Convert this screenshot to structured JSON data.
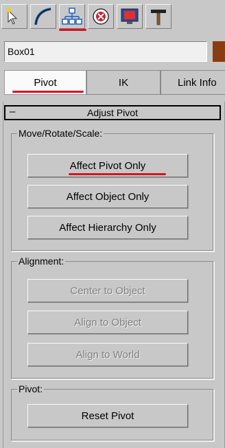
{
  "toolbar": {
    "icons": [
      "create-icon",
      "modify-icon",
      "hierarchy-icon",
      "motion-icon",
      "display-icon",
      "utilities-icon"
    ],
    "active": "hierarchy-icon",
    "accent": "#e0101a"
  },
  "object": {
    "name": "Box01",
    "color": "#8a3c12"
  },
  "tabs": [
    {
      "label": "Pivot"
    },
    {
      "label": "IK"
    },
    {
      "label": "Link Info"
    }
  ],
  "rollout": {
    "collapse_symbol": "–",
    "title": "Adjust Pivot",
    "move_group": {
      "legend": "Move/Rotate/Scale:",
      "buttons": [
        "Affect Pivot Only",
        "Affect Object Only",
        "Affect Hierarchy Only"
      ]
    },
    "alignment_group": {
      "legend": "Alignment:",
      "buttons": [
        "Center to Object",
        "Align to Object",
        "Align to World"
      ]
    },
    "pivot_group": {
      "legend": "Pivot:",
      "buttons": [
        "Reset Pivot"
      ]
    }
  }
}
